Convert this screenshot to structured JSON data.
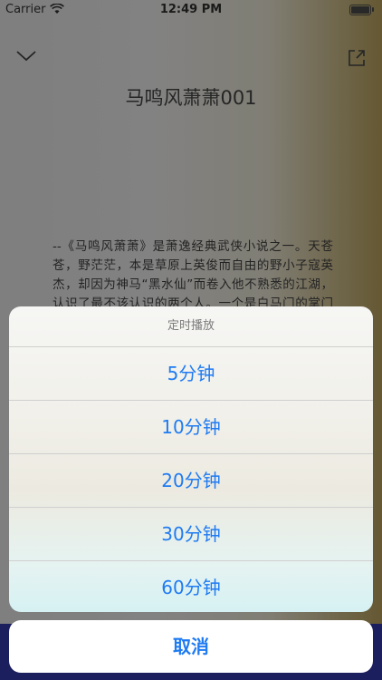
{
  "status_bar": {
    "carrier": "Carrier",
    "time": "12:49 PM",
    "icons": [
      "wifi-icon",
      "battery-icon"
    ]
  },
  "header": {
    "title": "马鸣风萧萧001",
    "icons": [
      "chevron-down-icon",
      "share-icon"
    ]
  },
  "content": {
    "text": "--《马鸣风萧萧》是萧逸经典武侠小说之一。天苍苍，野茫茫，本是草原上英俊而自由的野小子寇英杰，却因为神马“黑水仙”而卷入他不熟悉的江湖，认识了最不该认识的两个人。一个是白马门的掌门郭白云，因此而成为郭白云的关门弟"
  },
  "action_sheet": {
    "title": "定时播放",
    "options": [
      "5分钟",
      "10分钟",
      "20分钟",
      "30分钟",
      "60分钟"
    ],
    "cancel_label": "取消"
  },
  "colors": {
    "accent": "#1f7bf2",
    "sheet_title": "#7b7b7b",
    "bottom_strip": "#1c1f5e"
  }
}
